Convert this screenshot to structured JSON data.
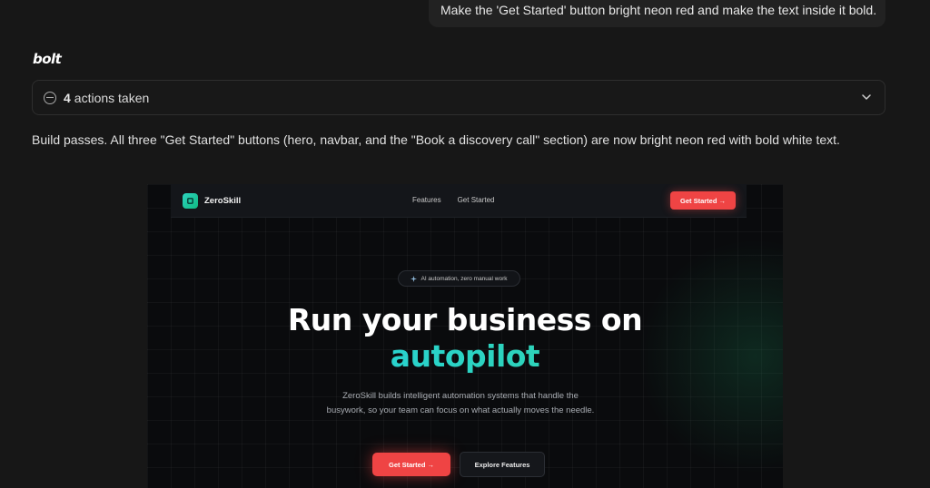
{
  "chat": {
    "user_message": "Make the 'Get Started' button bright neon red and make the text inside it bold.",
    "assistant_name": "bolt",
    "actions": {
      "count": "4",
      "label": "actions taken"
    },
    "result_text": "Build passes. All three \"Get Started\" buttons (hero, navbar, and the \"Book a discovery call\" section) are now bright neon red with bold white text."
  },
  "preview": {
    "brand": "ZeroSkill",
    "nav_links": [
      "Features",
      "Get Started"
    ],
    "nav_cta": "Get Started →",
    "badge": "AI automation, zero manual work",
    "hero_title": "Run your business on",
    "hero_accent": "autopilot",
    "hero_description": "ZeroSkill builds intelligent automation systems that handle the busywork, so your team can focus on what actually moves the needle.",
    "primary_cta": "Get Started →",
    "secondary_cta": "Explore Features"
  },
  "colors": {
    "background": "#171717",
    "neon_red": "#ef4444",
    "accent_teal": "#2dd4bf"
  },
  "icons": [
    "circle-minus-icon",
    "chevron-down-icon",
    "brand-logo-icon",
    "sparkle-icon"
  ]
}
